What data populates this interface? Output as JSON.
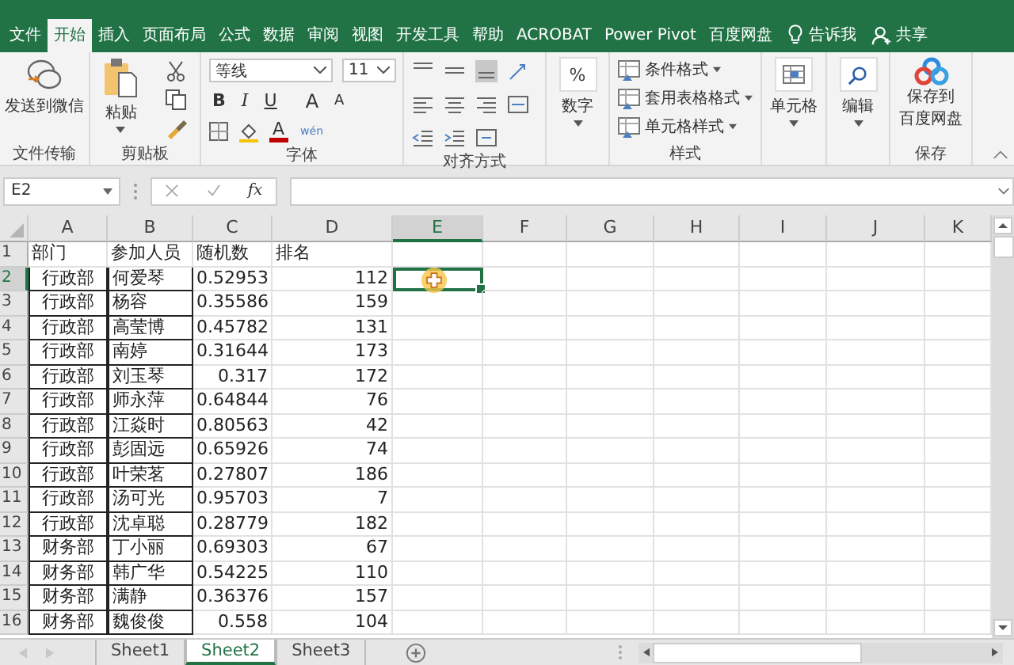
{
  "ribbon_tabs": [
    {
      "label": "文件",
      "selected": false
    },
    {
      "label": "开始",
      "selected": true
    },
    {
      "label": "插入",
      "selected": false
    },
    {
      "label": "页面布局",
      "selected": false
    },
    {
      "label": "公式",
      "selected": false
    },
    {
      "label": "数据",
      "selected": false
    },
    {
      "label": "审阅",
      "selected": false
    },
    {
      "label": "视图",
      "selected": false
    },
    {
      "label": "开发工具",
      "selected": false
    },
    {
      "label": "帮助",
      "selected": false
    },
    {
      "label": "ACROBAT",
      "selected": false
    },
    {
      "label": "Power Pivot",
      "selected": false
    },
    {
      "label": "百度网盘",
      "selected": false
    }
  ],
  "tell_me": "告诉我",
  "share": "共享",
  "ribbon": {
    "wechat": {
      "label": "发送到微信",
      "group": "文件传输"
    },
    "clipboard": {
      "paste": "粘贴",
      "group": "剪贴板"
    },
    "font": {
      "name": "等线",
      "size": "11",
      "styles": [
        "B",
        "I",
        "U"
      ],
      "grow": "A",
      "shrink": "A",
      "color_letter": "A",
      "phonetic": "wén",
      "group": "字体"
    },
    "alignment": {
      "group": "对齐方式"
    },
    "number": {
      "glyph": "%",
      "label": "数字"
    },
    "styles": {
      "items": [
        "条件格式",
        "套用表格格式",
        "单元格样式"
      ],
      "group": "样式"
    },
    "cells": {
      "label": "单元格"
    },
    "editing": {
      "label": "编辑"
    },
    "save": {
      "lines": [
        "保存到",
        "百度网盘"
      ],
      "group": "保存"
    }
  },
  "formula_bar": {
    "name_box": "E2",
    "fx": "fx"
  },
  "columns": [
    {
      "label": "A",
      "selected": false
    },
    {
      "label": "B",
      "selected": false
    },
    {
      "label": "C",
      "selected": false
    },
    {
      "label": "D",
      "selected": false
    },
    {
      "label": "E",
      "selected": true
    },
    {
      "label": "F",
      "selected": false
    },
    {
      "label": "G",
      "selected": false
    },
    {
      "label": "H",
      "selected": false
    },
    {
      "label": "I",
      "selected": false
    },
    {
      "label": "J",
      "selected": false
    },
    {
      "label": "K",
      "selected": false
    }
  ],
  "rows": [
    {
      "number": "1",
      "kind": "heading",
      "selected": false,
      "cells": [
        "部门",
        "参加人员",
        "随机数",
        "排名"
      ]
    },
    {
      "number": "2",
      "kind": "record",
      "selected": true,
      "cells": [
        "行政部",
        "何爱琴",
        "0.52953",
        "112"
      ]
    },
    {
      "number": "3",
      "kind": "record",
      "selected": false,
      "cells": [
        "行政部",
        "杨容",
        "0.35586",
        "159"
      ]
    },
    {
      "number": "4",
      "kind": "record",
      "selected": false,
      "cells": [
        "行政部",
        "高莹博",
        "0.45782",
        "131"
      ]
    },
    {
      "number": "5",
      "kind": "record",
      "selected": false,
      "cells": [
        "行政部",
        "南婷",
        "0.31644",
        "173"
      ]
    },
    {
      "number": "6",
      "kind": "record",
      "selected": false,
      "cells": [
        "行政部",
        "刘玉琴",
        "0.317",
        "172"
      ]
    },
    {
      "number": "7",
      "kind": "record",
      "selected": false,
      "cells": [
        "行政部",
        "师永萍",
        "0.64844",
        "76"
      ]
    },
    {
      "number": "8",
      "kind": "record",
      "selected": false,
      "cells": [
        "行政部",
        "江焱时",
        "0.80563",
        "42"
      ]
    },
    {
      "number": "9",
      "kind": "record",
      "selected": false,
      "cells": [
        "行政部",
        "彭固远",
        "0.65926",
        "74"
      ]
    },
    {
      "number": "10",
      "kind": "record",
      "selected": false,
      "cells": [
        "行政部",
        "叶荣茗",
        "0.27807",
        "186"
      ]
    },
    {
      "number": "11",
      "kind": "record",
      "selected": false,
      "cells": [
        "行政部",
        "汤可光",
        "0.95703",
        "7"
      ]
    },
    {
      "number": "12",
      "kind": "record",
      "selected": false,
      "cells": [
        "行政部",
        "沈卓聪",
        "0.28779",
        "182"
      ]
    },
    {
      "number": "13",
      "kind": "record",
      "selected": false,
      "cells": [
        "财务部",
        "丁小丽",
        "0.69303",
        "67"
      ]
    },
    {
      "number": "14",
      "kind": "record",
      "selected": false,
      "cells": [
        "财务部",
        "韩广华",
        "0.54225",
        "110"
      ]
    },
    {
      "number": "15",
      "kind": "record",
      "selected": false,
      "cells": [
        "财务部",
        "满静",
        "0.36376",
        "157"
      ]
    },
    {
      "number": "16",
      "kind": "record",
      "selected": false,
      "cells": [
        "财务部",
        "魏俊俊",
        "0.558",
        "104"
      ]
    }
  ],
  "sheet_tabs": [
    {
      "label": "Sheet1",
      "selected": false
    },
    {
      "label": "Sheet2",
      "selected": true
    },
    {
      "label": "Sheet3",
      "selected": false
    }
  ]
}
